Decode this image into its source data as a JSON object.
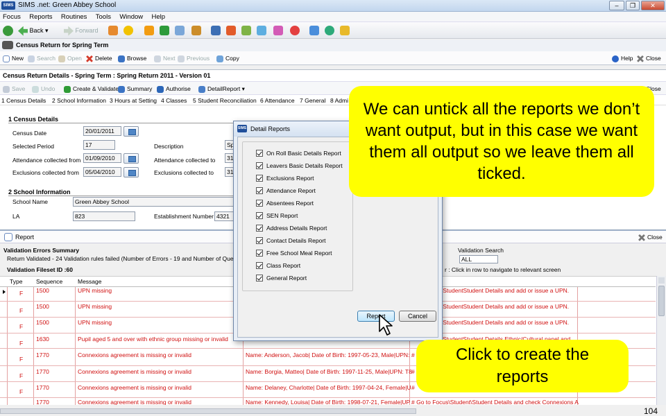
{
  "window": {
    "app_icon": "SIMS",
    "title": "SIMS .net: Green Abbey School",
    "min": "–",
    "max": "❐",
    "close": "✕"
  },
  "menu": [
    "Focus",
    "Reports",
    "Routines",
    "Tools",
    "Window",
    "Help"
  ],
  "toolbar": {
    "back": "Back",
    "forward": "Forward"
  },
  "census_panel": {
    "title": "Census Return for Spring Term",
    "new": "New",
    "search": "Search",
    "open": "Open",
    "delete": "Delete",
    "browse": "Browse",
    "next": "Next",
    "previous": "Previous",
    "copy": "Copy",
    "help": "Help",
    "close": "Close"
  },
  "details_panel": {
    "title": "Census Return Details - Spring Term : Spring Return 2011 - Version 01",
    "save": "Save",
    "undo": "Undo",
    "create_validate": "Create & Validate",
    "summary": "Summary",
    "authorise": "Authorise",
    "detail_report": "DetailReport",
    "close": "Close",
    "nav_links": [
      "1 Census Details",
      "2 School Information",
      "3 Hours at Setting",
      "4 Classes",
      "5 Student Reconciliation",
      "6 Attendance",
      "7 General",
      "8 Admi"
    ]
  },
  "census_details": {
    "heading": "1 Census Details",
    "census_date_label": "Census Date",
    "census_date": "20/01/2011",
    "selected_period_label": "Selected Period",
    "selected_period": "17",
    "description_label": "Description",
    "description": "Sp",
    "attendance_from_label": "Attendance collected from",
    "attendance_from": "01/09/2010",
    "attendance_to_label": "Attendance collected to",
    "attendance_to": "31",
    "exclusions_from_label": "Exclusions collected from",
    "exclusions_from": "05/04/2010",
    "exclusions_to_label": "Exclusions collected to",
    "exclusions_to": "31"
  },
  "school_info": {
    "heading": "2 School Information",
    "school_name_label": "School Name",
    "school_name": "Green Abbey School",
    "la_label": "LA",
    "la": "823",
    "establishment_label": "Establishment Number",
    "establishment": "4321"
  },
  "report_panel": {
    "title": "Report",
    "close": "Close",
    "summary_heading": "Validation Errors Summary",
    "summary_text": "Return Validated - 24 Validation rules failed (Number of Errors - 19 and Number of Queri",
    "fileset": "Validation Fileset ID :60",
    "validation_search_label": "Validation Search",
    "validation_search_value": "ALL",
    "hint": "r : Click in row to navigate to relevant screen",
    "columns": [
      "Type",
      "Sequence",
      "Message"
    ],
    "rows": [
      {
        "type": "F",
        "seq": "1500",
        "msg": "UPN missing",
        "detail": "",
        "action": "sStudentStudent Details and add or issue a UPN."
      },
      {
        "type": "F",
        "seq": "1500",
        "msg": "UPN missing",
        "detail": "",
        "action": "sStudentStudent Details and add or issue a UPN."
      },
      {
        "type": "F",
        "seq": "1500",
        "msg": "UPN missing",
        "detail": "",
        "action": "sStudentStudent Details and add or issue a UPN."
      },
      {
        "type": "F",
        "seq": "1630",
        "msg": "Pupil aged 5 and over with ethnic group missing or invalid",
        "detail": "",
        "action": "StudentStudent Details Ethnic/Cultural panel and"
      },
      {
        "type": "F",
        "seq": "1770",
        "msg": "Connexions agreement is missing or invalid",
        "detail": "Name: Anderson, Jacob| Date of Birth: 1997-05-23, Male|UPN:",
        "action": "#"
      },
      {
        "type": "F",
        "seq": "1770",
        "msg": "Connexions agreement is missing or invalid",
        "detail": "Name: Borgia, Matteo| Date of Birth: 1997-11-25, Male|UPN: T8",
        "action": "#"
      },
      {
        "type": "F",
        "seq": "1770",
        "msg": "Connexions agreement is missing or invalid",
        "detail": "Name: Delaney, Charlotte| Date of Birth: 1997-04-24, Female|U",
        "action": "#"
      },
      {
        "type": "",
        "seq": "1770",
        "msg": "Connexions agreement is missing or invalid",
        "detail": "Name: Kennedy, Louisa| Date of Birth: 1998-07-21, Female|UP",
        "action": "# Go to Focus\\Student\\Student Details and check Connexions A"
      }
    ]
  },
  "dialog": {
    "icon": "SIMS",
    "title": "Detail Reports",
    "reports": [
      "On Roll Basic Details Report",
      "Leavers Basic Details Report",
      "Exclusions Report",
      "Attendance Report",
      "Absentees Report",
      "SEN Report",
      "Address Details Report",
      "Contact Details Report",
      "Free School Meal Report",
      "Class Report",
      "General Report"
    ],
    "report_button": "Report",
    "cancel_button": "Cancel"
  },
  "callouts": {
    "top": "We can untick all the reports we don’t want output, but in this case we want them all output so we leave them all ticked.",
    "bottom": "Click to create the reports"
  },
  "slide_number": "104",
  "colors": {
    "callout": "#ffff00",
    "error_text": "#d01010",
    "titlebar": "#c2d6ee"
  }
}
